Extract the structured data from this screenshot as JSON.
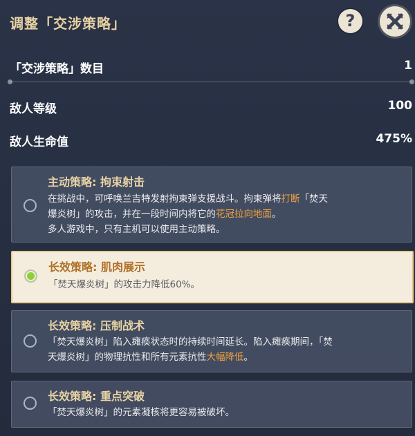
{
  "header": {
    "title": "调整「交涉策略」",
    "help_label": "?"
  },
  "stats": [
    {
      "label": "「交涉策略」数目",
      "value": "1"
    },
    {
      "label": "敌人等级",
      "value": "100"
    },
    {
      "label": "敌人生命值",
      "value": "475%"
    }
  ],
  "strategies": [
    {
      "title": "主动策略: 拘束射击",
      "selected": false,
      "desc_line1_a": "在挑战中，可呼唤兰吉特发射拘束弹支援战斗。拘束弹将",
      "desc_line1_hl": "打断",
      "desc_line1_b": "「焚天",
      "desc_line2_a": "爆炎树」的攻击，并在一段时间内将它的",
      "desc_line2_hl": "花冠拉向地面",
      "desc_line2_b": "。",
      "desc_line3": "多人游戏中，只有主机可以使用主动策略。"
    },
    {
      "title": "长效策略: 肌肉展示",
      "selected": true,
      "desc_line1": "「焚天爆炎树」的攻击力降低60%。"
    },
    {
      "title": "长效策略: 压制战术",
      "selected": false,
      "desc_line1": "「焚天爆炎树」陷入瘫痪状态时的持续时间延长。陷入瘫痪期间，「焚",
      "desc_line2_a": "天爆炎树」的物理抗性和所有元素抗性",
      "desc_line2_hl": "大幅降低",
      "desc_line2_b": "。"
    },
    {
      "title": "长效策略: 重点突破",
      "selected": false,
      "desc_line1": "「焚天爆炎树」的元素凝核将更容易被破坏。"
    }
  ],
  "colors": {
    "title_gold": "#e8d3a4",
    "highlight_orange": "#f3a240",
    "selected_bg": "#f4edde",
    "radio_green": "#8bd137"
  }
}
